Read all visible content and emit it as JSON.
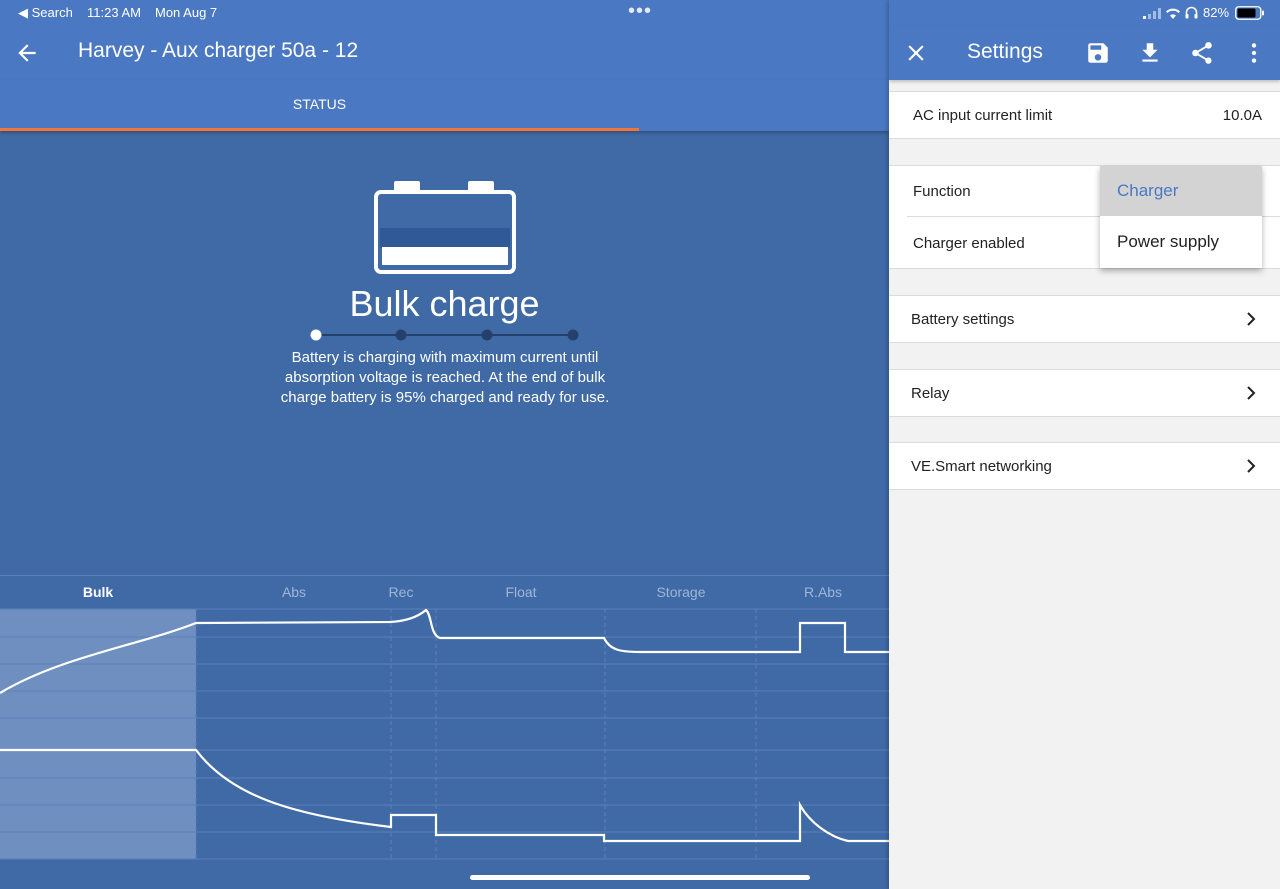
{
  "status_bar": {
    "back_label": "◀ Search",
    "time": "11:23 AM",
    "date": "Mon Aug 7",
    "battery_percent": "82%"
  },
  "header": {
    "title": "Harvey - Aux charger 50a - 12"
  },
  "tabs": [
    {
      "label": "STATUS",
      "active": true
    }
  ],
  "status": {
    "state_title": "Bulk charge",
    "description": "Battery is charging with maximum current until absorption voltage is reached. At the end of bulk charge battery is 95% charged and ready for use.",
    "step_count": 4,
    "active_step": 1
  },
  "charge_chart": {
    "phases": [
      "Bulk",
      "Abs",
      "Rec",
      "Float",
      "Storage",
      "R.Abs"
    ],
    "active_phase": "Bulk"
  },
  "settings_panel": {
    "title": "Settings",
    "icons": [
      "close-icon",
      "save-icon",
      "download-icon",
      "share-icon",
      "more-vert-icon"
    ],
    "rows": {
      "ac_input_limit": {
        "label": "AC input current limit",
        "value": "10.0A"
      },
      "function": {
        "label": "Function"
      },
      "charger_enabled": {
        "label": "Charger enabled"
      },
      "battery_settings": {
        "label": "Battery settings"
      },
      "relay": {
        "label": "Relay"
      },
      "ve_smart": {
        "label": "VE.Smart networking"
      }
    },
    "function_dropdown": {
      "options": [
        "Charger",
        "Power supply"
      ],
      "selected": "Charger"
    }
  },
  "colors": {
    "app_bar": "#4a78c2",
    "background": "#3f6aa6",
    "tab_indicator": "#f2753a",
    "selected_option_text": "#4a78c2"
  }
}
